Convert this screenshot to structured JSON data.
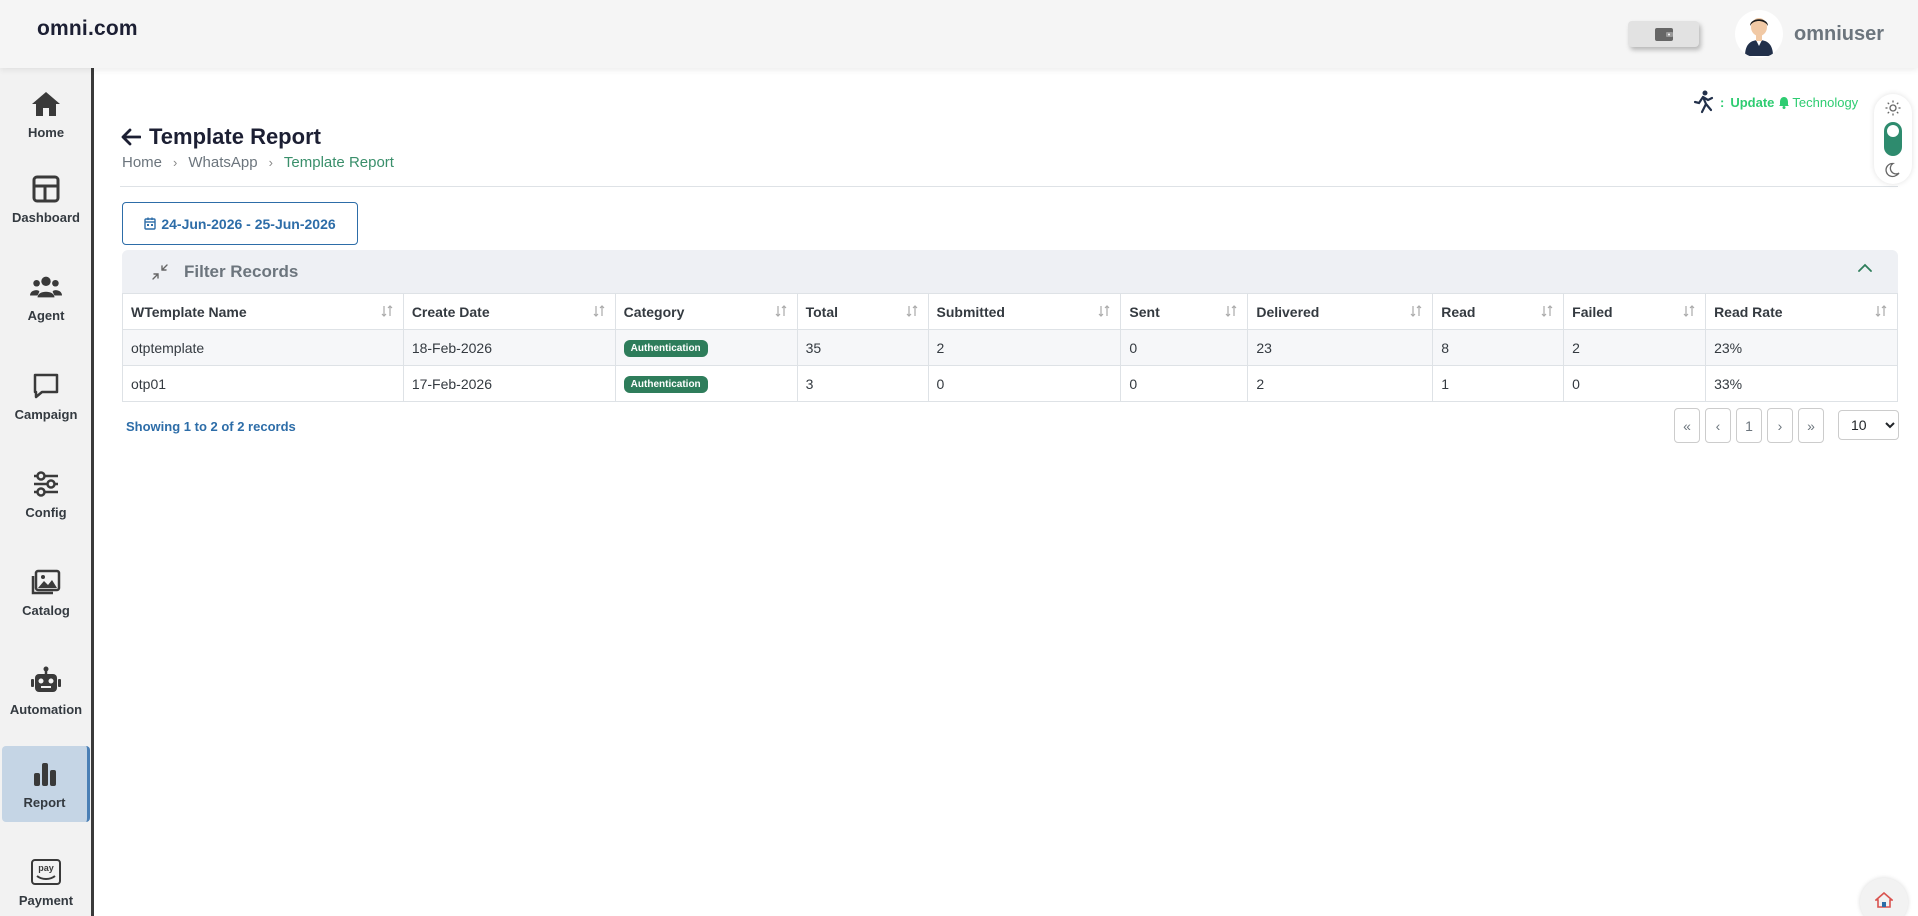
{
  "header": {
    "brand": "omni.com",
    "username": "omniuser"
  },
  "sidebar": {
    "items": [
      {
        "label": "Home",
        "icon": "home-icon"
      },
      {
        "label": "Dashboard",
        "icon": "dashboard-icon"
      },
      {
        "label": "Agent",
        "icon": "agent-icon"
      },
      {
        "label": "Campaign",
        "icon": "campaign-icon"
      },
      {
        "label": "Config",
        "icon": "config-icon"
      },
      {
        "label": "Catalog",
        "icon": "catalog-icon"
      },
      {
        "label": "Automation",
        "icon": "automation-icon"
      },
      {
        "label": "Report",
        "icon": "report-icon",
        "active": true
      },
      {
        "label": "Payment",
        "icon": "payment-icon"
      }
    ]
  },
  "update_strip": {
    "prefix": ":",
    "label": "Update",
    "text": "Technology"
  },
  "page": {
    "title": "Template Report",
    "breadcrumb": [
      "Home",
      "WhatsApp",
      "Template Report"
    ]
  },
  "date_range": "24-Jun-2026 - 25-Jun-2026",
  "filter": {
    "title": "Filter Records"
  },
  "table": {
    "columns": [
      "WTemplate Name",
      "Create Date",
      "Category",
      "Total",
      "Submitted",
      "Sent",
      "Delivered",
      "Read",
      "Failed",
      "Read Rate"
    ],
    "rows": [
      {
        "name": "otptemplate",
        "create_date": "18-Feb-2026",
        "category": "Authentication",
        "total": "35",
        "submitted": "2",
        "sent": "0",
        "delivered": "23",
        "read": "8",
        "failed": "2",
        "read_rate": "23%"
      },
      {
        "name": "otp01",
        "create_date": "17-Feb-2026",
        "category": "Authentication",
        "total": "3",
        "submitted": "0",
        "sent": "0",
        "delivered": "2",
        "read": "1",
        "failed": "0",
        "read_rate": "33%"
      }
    ]
  },
  "records_info": "Showing 1 to 2 of 2 records",
  "pagination": {
    "first": "«",
    "prev": "‹",
    "current": "1",
    "next": "›",
    "last": "»",
    "page_size": "10"
  },
  "colors": {
    "accent_blue": "#2d6da8",
    "accent_green": "#3a8f6b",
    "badge_green": "#2e7d5b"
  }
}
